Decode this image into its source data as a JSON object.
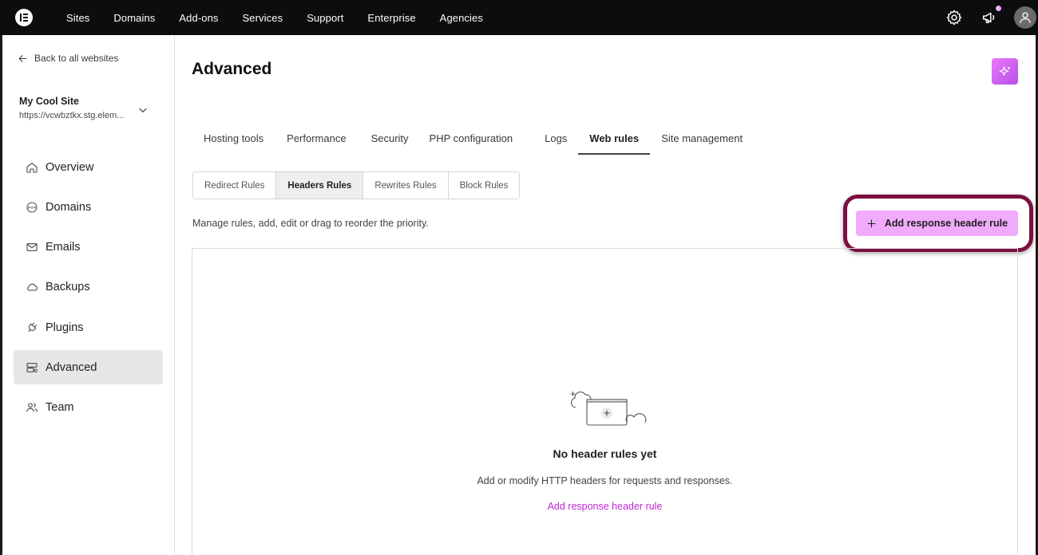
{
  "topnav": {
    "items": [
      "Sites",
      "Domains",
      "Add-ons",
      "Services",
      "Support",
      "Enterprise",
      "Agencies"
    ],
    "icons": [
      "settings-icon",
      "megaphone-icon",
      "user-avatar-icon"
    ],
    "notification_dot_color": "#f0abfc"
  },
  "sidebar": {
    "back_label": "Back to all websites",
    "site_name": "My Cool Site",
    "site_url": "https://vcwbztkx.stg.elem...",
    "items": [
      {
        "label": "Overview",
        "icon": "home-icon"
      },
      {
        "label": "Domains",
        "icon": "www-globe-icon"
      },
      {
        "label": "Emails",
        "icon": "mail-icon"
      },
      {
        "label": "Backups",
        "icon": "cloud-icon"
      },
      {
        "label": "Plugins",
        "icon": "plug-icon"
      },
      {
        "label": "Advanced",
        "icon": "server-settings-icon",
        "active": true
      },
      {
        "label": "Team",
        "icon": "team-icon"
      }
    ]
  },
  "main": {
    "title": "Advanced",
    "tabs": [
      "Hosting tools",
      "Performance",
      "Security",
      "PHP configuration",
      "Logs",
      "Web rules",
      "Site management"
    ],
    "active_tab": "Web rules",
    "subtabs": [
      "Redirect Rules",
      "Headers Rules",
      "Rewrites Rules",
      "Block Rules"
    ],
    "active_subtab": "Headers Rules",
    "description": "Manage rules, add, edit or drag to reorder the priority.",
    "primary_button": "Add response header rule",
    "empty_state": {
      "title": "No header rules yet",
      "subtitle": "Add or modify HTTP headers for requests and responses.",
      "link": "Add response header rule"
    }
  },
  "colors": {
    "accent": "#f0abfc",
    "link": "#c026d3",
    "highlight_ring": "#7b1040",
    "topbar": "#0c0d0e"
  }
}
